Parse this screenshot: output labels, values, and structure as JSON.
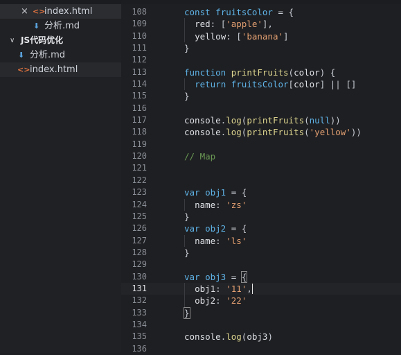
{
  "sidebar": {
    "open_editors": [
      {
        "name": "index.html",
        "type": "html",
        "close": "×"
      },
      {
        "name": "分析.md",
        "type": "md"
      }
    ],
    "folder": {
      "name": "JS代码优化",
      "chevron": "∨"
    },
    "files": [
      {
        "name": "分析.md",
        "type": "md"
      },
      {
        "name": "index.html",
        "type": "html"
      }
    ],
    "icons": {
      "html": "<>",
      "md": "⬇"
    }
  },
  "editor": {
    "current_line": 131,
    "lines": [
      {
        "n": "108",
        "code": "const fruitsColor = {"
      },
      {
        "n": "109",
        "code": "  red: ['apple'],"
      },
      {
        "n": "110",
        "code": "  yellow: ['banana']"
      },
      {
        "n": "111",
        "code": "}"
      },
      {
        "n": "112",
        "code": ""
      },
      {
        "n": "113",
        "code": "function printFruits(color) {"
      },
      {
        "n": "114",
        "code": "  return fruitsColor[color] || []"
      },
      {
        "n": "115",
        "code": "}"
      },
      {
        "n": "116",
        "code": ""
      },
      {
        "n": "117",
        "code": "console.log(printFruits(null))"
      },
      {
        "n": "118",
        "code": "console.log(printFruits('yellow'))"
      },
      {
        "n": "119",
        "code": ""
      },
      {
        "n": "120",
        "code": "// Map"
      },
      {
        "n": "121",
        "code": ""
      },
      {
        "n": "122",
        "code": ""
      },
      {
        "n": "123",
        "code": "var obj1 = {"
      },
      {
        "n": "124",
        "code": "  name: 'zs'"
      },
      {
        "n": "125",
        "code": "}"
      },
      {
        "n": "126",
        "code": "var obj2 = {"
      },
      {
        "n": "127",
        "code": "  name: 'ls'"
      },
      {
        "n": "128",
        "code": "}"
      },
      {
        "n": "129",
        "code": ""
      },
      {
        "n": "130",
        "code": "var obj3 = {"
      },
      {
        "n": "131",
        "code": "  obj1: '11',"
      },
      {
        "n": "132",
        "code": "  obj2: '22'"
      },
      {
        "n": "133",
        "code": "}"
      },
      {
        "n": "134",
        "code": ""
      },
      {
        "n": "135",
        "code": "console.log(obj3)"
      },
      {
        "n": "136",
        "code": ""
      }
    ]
  }
}
